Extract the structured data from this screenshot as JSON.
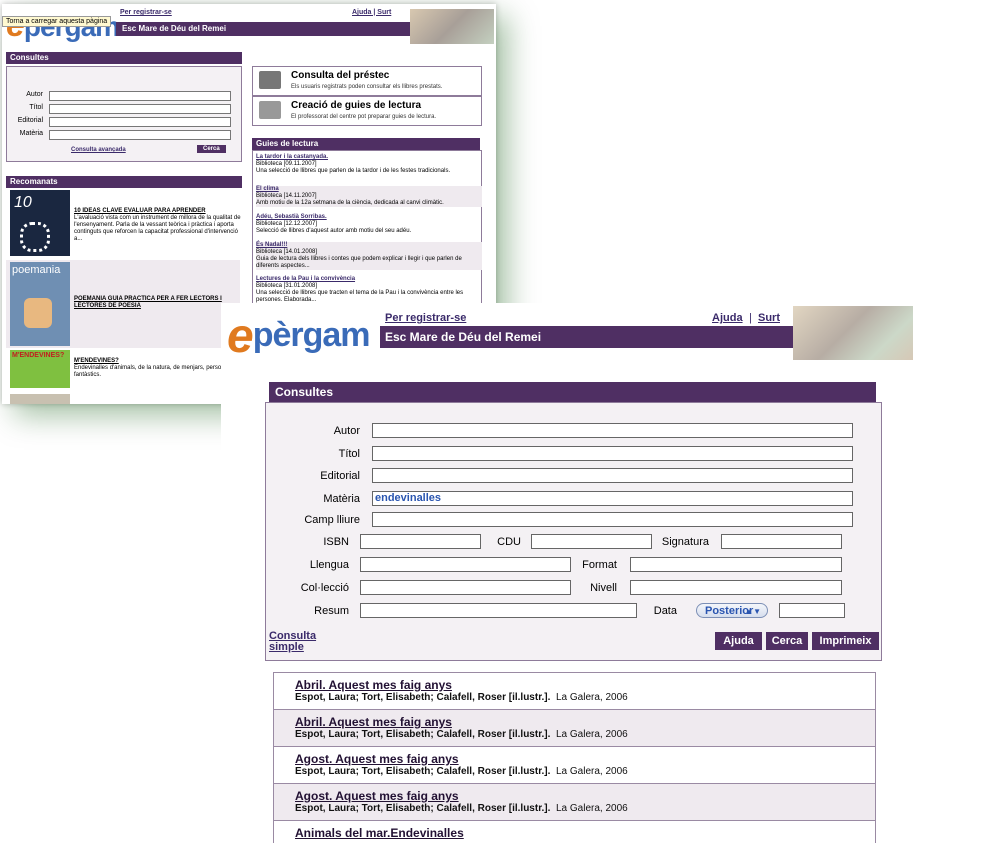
{
  "back": {
    "tooltip": "Torna a carregar aquesta pàgina",
    "register": "Per registrar-se",
    "help_links": "Ajuda   | Surt",
    "school": "Esc Mare de Déu del Remei",
    "logo_e": "e",
    "logo_rest": "pergam",
    "consultes_title": "Consultes",
    "fields": [
      "Autor",
      "Títol",
      "Editorial",
      "Matèria"
    ],
    "advanced": "Consulta avançada",
    "search_btn": "Cerca",
    "loan_title": "Consulta del préstec",
    "loan_sub": "Els usuaris registrats poden consultar els llibres prestats.",
    "guides_create_title": "Creació de guies de lectura",
    "guides_create_sub": "El professorat del centre pot preparar guies de lectura.",
    "guides_title": "Guies de lectura",
    "guides": [
      {
        "title": "La tardor i la castanyada.",
        "meta": "Biblioteca [09.11.2007]",
        "desc": "Una selecció de llibres que parlen de la tardor i de les festes tradicionals."
      },
      {
        "title": "El clima",
        "meta": "Biblioteca [14.11.2007]",
        "desc": "Amb motiu de la 12a setmana de la ciència, dedicada al canvi climàtic."
      },
      {
        "title": "Adéu, Sebastià Sorribas.",
        "meta": "Biblioteca [12.12.2007]",
        "desc": "Selecció de llibres d'aquest autor amb motiu del seu adéu."
      },
      {
        "title": "És Nadal!!!",
        "meta": "Biblioteca [14.01.2008]",
        "desc": "Guia de lectura dels llibres i contes que podem explicar i llegir i que parlen de diferents aspectes..."
      },
      {
        "title": "Lectures de la Pau i la convivència",
        "meta": "Biblioteca [31.01.2008]",
        "desc": "Una selecció de llibres que tracten el tema de la Pau i la convivència entre les persones. Elaborada..."
      }
    ],
    "recomanats_title": "Recomanats",
    "recs": [
      {
        "title": "10 IDEAS CLAVE EVALUAR PARA APRENDER",
        "desc": "L'avaluació vista com un instrument de millora de la qualitat de l'ensenyament. Parla de la vessant teòrica i pràctica i aporta continguts que reforcen la capacitat professional d'intervenció a..."
      },
      {
        "title": "POEMANIA GUIA PRACTICA PER A FER LECTORS I LECTORES DE POESIA",
        "desc": ""
      },
      {
        "title": "M'ENDEVINES?",
        "desc": "Endevinalles d'animals, de la natura, de menjars, personatges fantàstics."
      }
    ],
    "cover_texts": [
      "10",
      "poemania",
      "M'ENDEVINES?"
    ]
  },
  "front": {
    "logo_e": "e",
    "logo_rest": "pèrgam",
    "register": "Per registrar-se",
    "help": "Ajuda",
    "sep": "|",
    "surt": "Surt",
    "school": "Esc Mare de Déu del Remei",
    "consultes_title": "Consultes",
    "labels": {
      "autor": "Autor",
      "titol": "Títol",
      "editorial": "Editorial",
      "materia": "Matèria",
      "camp": "Camp lliure",
      "isbn": "ISBN",
      "cdu": "CDU",
      "signatura": "Signatura",
      "llengua": "Llengua",
      "format": "Format",
      "colleccio": "Col·lecció",
      "nivell": "Nivell",
      "resum": "Resum",
      "data": "Data"
    },
    "materia_value": "endevinalles",
    "data_select": "Posterior",
    "consulta_simple_1": "Consulta",
    "consulta_simple_2": "simple",
    "buttons": {
      "ajuda": "Ajuda",
      "cerca": "Cerca",
      "imprimeix": "Imprimeix"
    },
    "results": [
      {
        "title": "Abril. Aquest mes faig anys",
        "authors": "Espot, Laura; Tort, Elisabeth; Calafell, Roser [il.lustr.].",
        "pub": "La Galera, 2006"
      },
      {
        "title": "Abril. Aquest mes faig anys",
        "authors": "Espot, Laura; Tort, Elisabeth; Calafell, Roser [il.lustr.].",
        "pub": "La Galera, 2006"
      },
      {
        "title": "Agost. Aquest mes faig anys",
        "authors": "Espot, Laura; Tort, Elisabeth; Calafell, Roser [il.lustr.].",
        "pub": "La Galera, 2006"
      },
      {
        "title": "Agost. Aquest mes faig anys",
        "authors": "Espot, Laura; Tort, Elisabeth; Calafell, Roser [il.lustr.].",
        "pub": "La Galera, 2006"
      },
      {
        "title": "Animals del mar.Endevinalles",
        "authors": "",
        "pub": ""
      }
    ]
  }
}
